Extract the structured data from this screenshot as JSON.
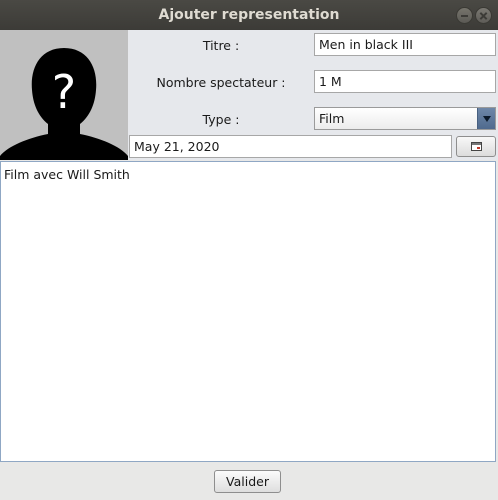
{
  "window": {
    "title": "Ajouter representation"
  },
  "form": {
    "titre_label": "Titre :",
    "titre_value": "Men in black III",
    "spectateurs_label": "Nombre spectateur :",
    "spectateurs_value": "1 M",
    "type_label": "Type :",
    "type_value": "Film",
    "date_value": "May 21, 2020"
  },
  "description": "Film avec Will Smith",
  "buttons": {
    "valider": "Valider"
  },
  "icons": {
    "photo": "unknown-person-icon",
    "date_picker": "calendar-icon"
  }
}
